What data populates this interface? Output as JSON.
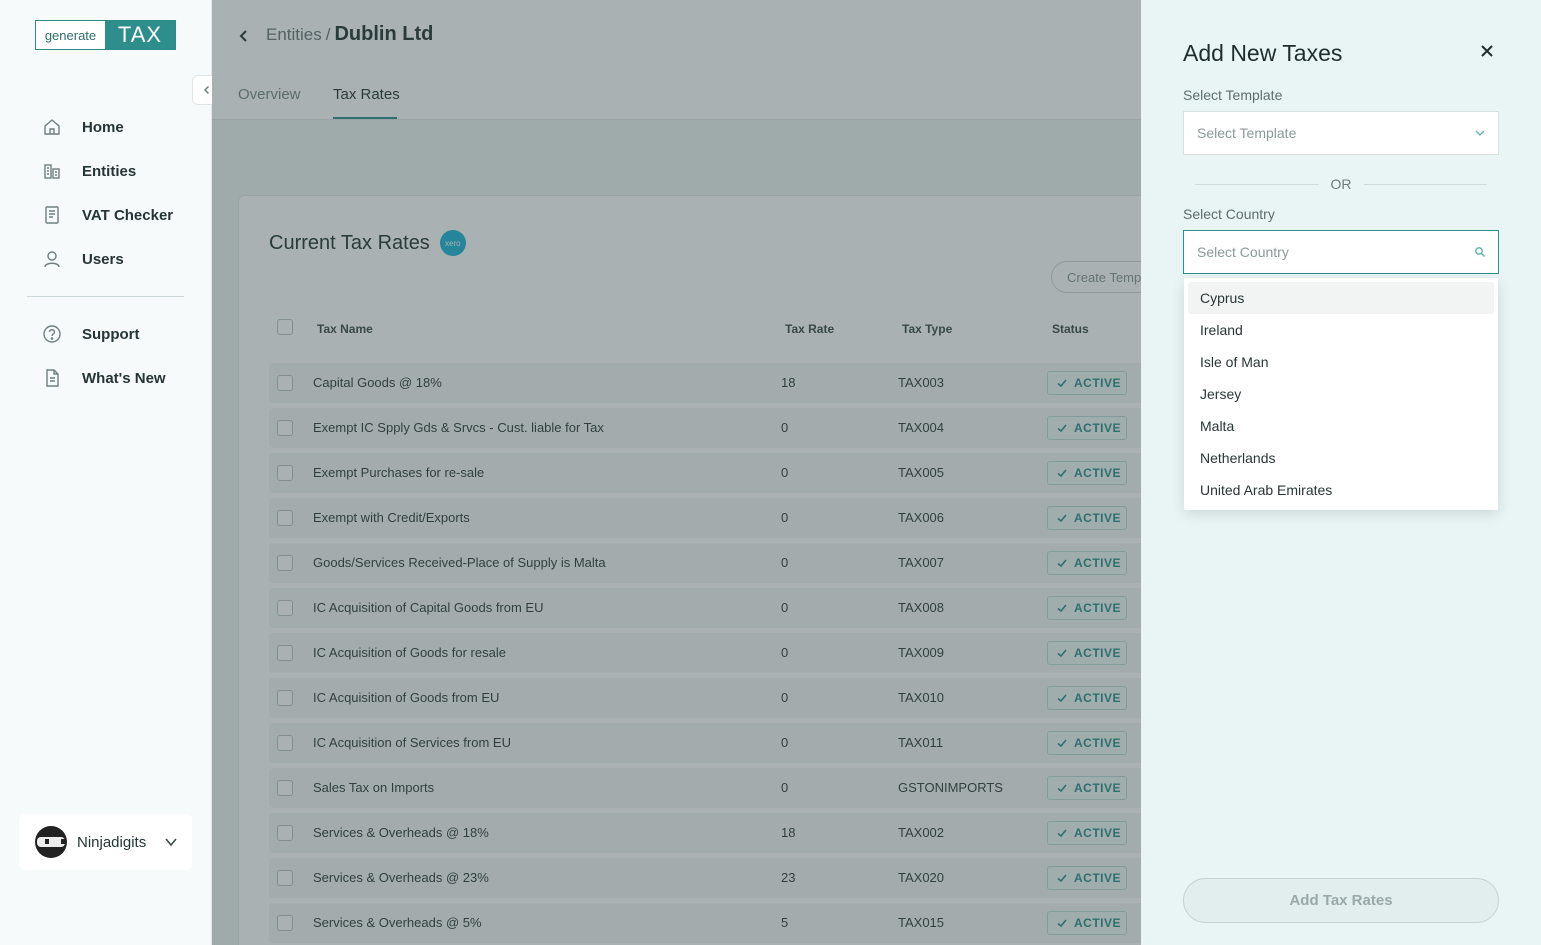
{
  "logo": {
    "part1": "generate",
    "part2": "TAX"
  },
  "sidebar": {
    "items": [
      {
        "label": "Home",
        "icon": "home-icon"
      },
      {
        "label": "Entities",
        "icon": "buildings-icon"
      },
      {
        "label": "VAT Checker",
        "icon": "document-icon"
      },
      {
        "label": "Users",
        "icon": "user-icon"
      },
      {
        "label": "Support",
        "icon": "help-icon"
      },
      {
        "label": "What's New",
        "icon": "news-icon"
      }
    ],
    "user": {
      "name": "Ninjadigits"
    }
  },
  "header": {
    "breadcrumb_parent": "Entities",
    "breadcrumb_sep": "/",
    "breadcrumb_current": "Dublin Ltd",
    "tabs": [
      "Overview",
      "Tax Rates"
    ],
    "active_tab": "Tax Rates"
  },
  "card": {
    "title": "Current Tax Rates",
    "xero_label": "xero",
    "create_button": "Create Temp",
    "columns": [
      "Tax Name",
      "Tax Rate",
      "Tax Type",
      "Status"
    ],
    "rows": [
      {
        "name": "Capital Goods @ 18%",
        "rate": "18",
        "type": "TAX003",
        "status": "ACTIVE"
      },
      {
        "name": "Exempt IC Spply Gds & Srvcs - Cust. liable for Tax",
        "rate": "0",
        "type": "TAX004",
        "status": "ACTIVE"
      },
      {
        "name": "Exempt Purchases for re-sale",
        "rate": "0",
        "type": "TAX005",
        "status": "ACTIVE"
      },
      {
        "name": "Exempt with Credit/Exports",
        "rate": "0",
        "type": "TAX006",
        "status": "ACTIVE"
      },
      {
        "name": "Goods/Services Received-Place of Supply is Malta",
        "rate": "0",
        "type": "TAX007",
        "status": "ACTIVE"
      },
      {
        "name": "IC Acquisition of Capital Goods from EU",
        "rate": "0",
        "type": "TAX008",
        "status": "ACTIVE"
      },
      {
        "name": "IC Acquisition of Goods for resale",
        "rate": "0",
        "type": "TAX009",
        "status": "ACTIVE"
      },
      {
        "name": "IC Acquisition of Goods from EU",
        "rate": "0",
        "type": "TAX010",
        "status": "ACTIVE"
      },
      {
        "name": "IC Acquisition of Services from EU",
        "rate": "0",
        "type": "TAX011",
        "status": "ACTIVE"
      },
      {
        "name": "Sales Tax on Imports",
        "rate": "0",
        "type": "GSTONIMPORTS",
        "status": "ACTIVE"
      },
      {
        "name": "Services & Overheads @ 18%",
        "rate": "18",
        "type": "TAX002",
        "status": "ACTIVE"
      },
      {
        "name": "Services & Overheads @ 23%",
        "rate": "23",
        "type": "TAX020",
        "status": "ACTIVE"
      },
      {
        "name": "Services & Overheads @ 5%",
        "rate": "5",
        "type": "TAX015",
        "status": "ACTIVE"
      }
    ]
  },
  "drawer": {
    "title": "Add New Taxes",
    "template_label": "Select Template",
    "template_placeholder": "Select Template",
    "or_text": "OR",
    "country_label": "Select Country",
    "country_placeholder": "Select Country",
    "countries": [
      "Cyprus",
      "Ireland",
      "Isle of Man",
      "Jersey",
      "Malta",
      "Netherlands",
      "United Arab Emirates"
    ],
    "highlighted_country": "Cyprus",
    "submit": "Add Tax Rates"
  },
  "colors": {
    "accent": "#2d8e8c",
    "overlay": "rgba(50,70,72,0.42)",
    "drawer_bg": "#e9f5f5"
  }
}
